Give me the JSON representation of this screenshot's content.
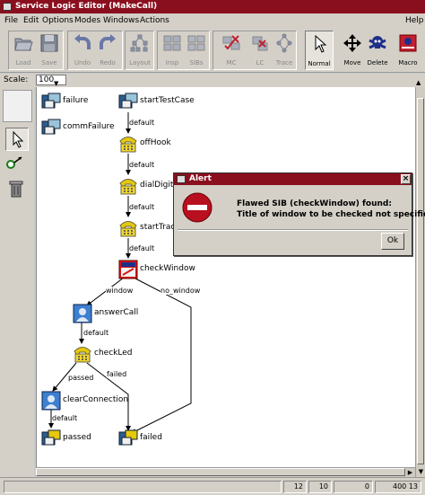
{
  "window": {
    "title": "Service Logic Editor (MakeCall)"
  },
  "menu": [
    "File",
    "Edit",
    "Options",
    "Modes",
    "Windows",
    "Actions",
    "Help"
  ],
  "toolbar": {
    "buttons": [
      {
        "id": "load",
        "label": "Load",
        "icon": "folder-open-icon",
        "enabled": false
      },
      {
        "id": "save",
        "label": "Save",
        "icon": "floppy-disk-icon",
        "enabled": false
      },
      {
        "id": "undo",
        "label": "Undo",
        "icon": "undo-arrow-icon",
        "enabled": false
      },
      {
        "id": "redo",
        "label": "Redo",
        "icon": "redo-arrow-icon",
        "enabled": false
      },
      {
        "id": "layout",
        "label": "Layout",
        "icon": "tree-layout-icon",
        "enabled": false
      },
      {
        "id": "insp",
        "label": "Insp",
        "icon": "inspector-grid-icon",
        "enabled": false
      },
      {
        "id": "sibs",
        "label": "SIBs",
        "icon": "sib-grid-icon",
        "enabled": false
      },
      {
        "id": "mc",
        "label": "MC",
        "icon": "model-check-icon",
        "enabled": false
      },
      {
        "id": "lc",
        "label": "LC",
        "icon": "local-check-icon",
        "enabled": false
      },
      {
        "id": "trace",
        "label": "Trace",
        "icon": "trace-graph-icon",
        "enabled": false
      },
      {
        "id": "normal",
        "label": "Normal",
        "icon": "pointer-arrow-icon",
        "enabled": true,
        "selected": true
      },
      {
        "id": "move",
        "label": "Move",
        "icon": "move-cross-icon",
        "enabled": true
      },
      {
        "id": "delete",
        "label": "Delete",
        "icon": "skull-crossbones-icon",
        "enabled": true
      },
      {
        "id": "macro",
        "label": "Macro",
        "icon": "macro-sib-icon",
        "enabled": true
      }
    ]
  },
  "scale": {
    "label": "Scale:",
    "value": "100"
  },
  "left_tools": [
    "select-pointer-icon",
    "connect-edge-icon",
    "trash-can-icon"
  ],
  "graph": {
    "nodes": [
      {
        "id": "failure",
        "label": "failure",
        "type": "sib"
      },
      {
        "id": "commFailure",
        "label": "commFailure",
        "type": "sib"
      },
      {
        "id": "startTestCase",
        "label": "startTestCase",
        "type": "sib"
      },
      {
        "id": "offHook",
        "label": "offHook",
        "type": "phone"
      },
      {
        "id": "dialDigits",
        "label": "dialDigits",
        "type": "phone"
      },
      {
        "id": "startTrace",
        "label": "startTrace",
        "type": "phone"
      },
      {
        "id": "checkWindow",
        "label": "checkWindow",
        "type": "window-flawed"
      },
      {
        "id": "answerCall",
        "label": "answerCall",
        "type": "call"
      },
      {
        "id": "checkLed",
        "label": "checkLed",
        "type": "phone"
      },
      {
        "id": "clearConnection",
        "label": "clearConnection",
        "type": "call"
      },
      {
        "id": "passed",
        "label": "passed",
        "type": "sib"
      },
      {
        "id": "failed",
        "label": "failed",
        "type": "sib"
      }
    ],
    "edges": [
      {
        "from": "startTestCase",
        "to": "offHook",
        "label": "default"
      },
      {
        "from": "offHook",
        "to": "dialDigits",
        "label": "default"
      },
      {
        "from": "dialDigits",
        "to": "startTrace",
        "label": "default"
      },
      {
        "from": "startTrace",
        "to": "checkWindow",
        "label": "default"
      },
      {
        "from": "checkWindow",
        "to": "answerCall",
        "label": "window"
      },
      {
        "from": "checkWindow",
        "to": "failed",
        "label": "no_window"
      },
      {
        "from": "answerCall",
        "to": "checkLed",
        "label": "default"
      },
      {
        "from": "checkLed",
        "to": "clearConnection",
        "label": "passed"
      },
      {
        "from": "checkLed",
        "to": "failed",
        "label": "failed"
      },
      {
        "from": "clearConnection",
        "to": "passed",
        "label": "default"
      }
    ]
  },
  "status": {
    "fields": [
      "12",
      "10",
      "0",
      "400 13"
    ]
  },
  "alert": {
    "title": "Alert",
    "line1": "Flawed SIB (checkWindow) found:",
    "line2": "Title of window to be checked not specified!",
    "ok_label": "Ok"
  },
  "colors": {
    "title_bg": "#8a0f1e",
    "chrome": "#d4d0c8",
    "canvas": "#ffffff"
  }
}
